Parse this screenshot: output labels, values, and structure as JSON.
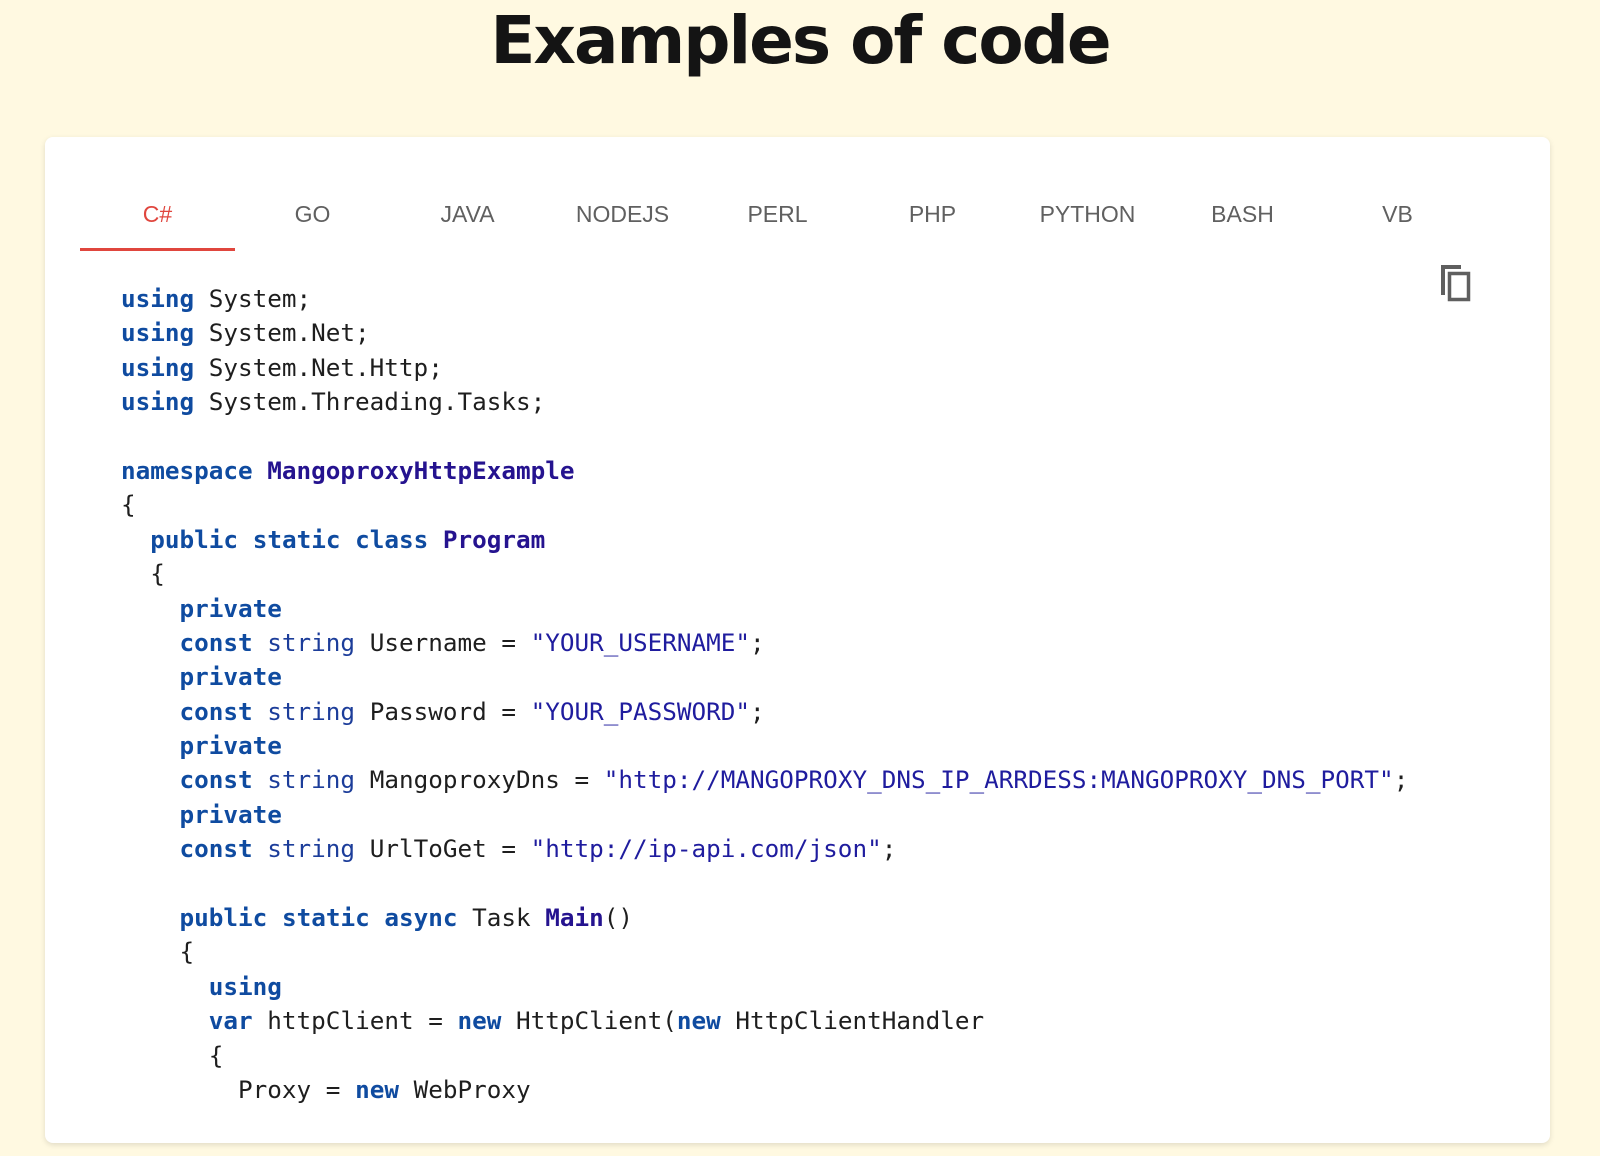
{
  "page": {
    "heading": "Examples of code"
  },
  "tabs": [
    {
      "label": "C#",
      "active": true
    },
    {
      "label": "GO",
      "active": false
    },
    {
      "label": "JAVA",
      "active": false
    },
    {
      "label": "NODEJS",
      "active": false
    },
    {
      "label": "PERL",
      "active": false
    },
    {
      "label": "PHP",
      "active": false
    },
    {
      "label": "PYTHON",
      "active": false
    },
    {
      "label": "BASH",
      "active": false
    },
    {
      "label": "VB",
      "active": false
    }
  ],
  "copy_button": {
    "icon": "copy-icon"
  },
  "colors": {
    "background": "#fff9e1",
    "accent": "#e0463e",
    "keyword": "#0f4ba0",
    "string": "#1f1c9e"
  },
  "code": {
    "language": "C#",
    "lines": [
      [
        {
          "t": "using",
          "c": "kw"
        },
        {
          "t": " System;",
          "c": "plain"
        }
      ],
      [
        {
          "t": "using",
          "c": "kw"
        },
        {
          "t": " System.Net;",
          "c": "plain"
        }
      ],
      [
        {
          "t": "using",
          "c": "kw"
        },
        {
          "t": " System.Net.Http;",
          "c": "plain"
        }
      ],
      [
        {
          "t": "using",
          "c": "kw"
        },
        {
          "t": " System.Threading.Tasks;",
          "c": "plain"
        }
      ],
      [],
      [
        {
          "t": "namespace",
          "c": "kw"
        },
        {
          "t": " ",
          "c": "plain"
        },
        {
          "t": "MangoproxyHttpExample",
          "c": "name"
        }
      ],
      [
        {
          "t": "{",
          "c": "plain"
        }
      ],
      [
        {
          "t": "  ",
          "c": "plain"
        },
        {
          "t": "public",
          "c": "kw"
        },
        {
          "t": " ",
          "c": "plain"
        },
        {
          "t": "static",
          "c": "kw"
        },
        {
          "t": " ",
          "c": "plain"
        },
        {
          "t": "class",
          "c": "kw"
        },
        {
          "t": " ",
          "c": "plain"
        },
        {
          "t": "Program",
          "c": "name"
        }
      ],
      [
        {
          "t": "  {",
          "c": "plain"
        }
      ],
      [
        {
          "t": "    ",
          "c": "plain"
        },
        {
          "t": "private",
          "c": "kw"
        }
      ],
      [
        {
          "t": "    ",
          "c": "plain"
        },
        {
          "t": "const",
          "c": "kw"
        },
        {
          "t": " ",
          "c": "plain"
        },
        {
          "t": "string",
          "c": "type"
        },
        {
          "t": " Username = ",
          "c": "plain"
        },
        {
          "t": "\"YOUR_USERNAME\"",
          "c": "str"
        },
        {
          "t": ";",
          "c": "plain"
        }
      ],
      [
        {
          "t": "    ",
          "c": "plain"
        },
        {
          "t": "private",
          "c": "kw"
        }
      ],
      [
        {
          "t": "    ",
          "c": "plain"
        },
        {
          "t": "const",
          "c": "kw"
        },
        {
          "t": " ",
          "c": "plain"
        },
        {
          "t": "string",
          "c": "type"
        },
        {
          "t": " Password = ",
          "c": "plain"
        },
        {
          "t": "\"YOUR_PASSWORD\"",
          "c": "str"
        },
        {
          "t": ";",
          "c": "plain"
        }
      ],
      [
        {
          "t": "    ",
          "c": "plain"
        },
        {
          "t": "private",
          "c": "kw"
        }
      ],
      [
        {
          "t": "    ",
          "c": "plain"
        },
        {
          "t": "const",
          "c": "kw"
        },
        {
          "t": " ",
          "c": "plain"
        },
        {
          "t": "string",
          "c": "type"
        },
        {
          "t": " MangoproxyDns = ",
          "c": "plain"
        },
        {
          "t": "\"http://MANGOPROXY_DNS_IP_ARRDESS:MANGOPROXY_DNS_PORT\"",
          "c": "str"
        },
        {
          "t": ";",
          "c": "plain"
        }
      ],
      [
        {
          "t": "    ",
          "c": "plain"
        },
        {
          "t": "private",
          "c": "kw"
        }
      ],
      [
        {
          "t": "    ",
          "c": "plain"
        },
        {
          "t": "const",
          "c": "kw"
        },
        {
          "t": " ",
          "c": "plain"
        },
        {
          "t": "string",
          "c": "type"
        },
        {
          "t": " UrlToGet = ",
          "c": "plain"
        },
        {
          "t": "\"http://ip-api.com/json\"",
          "c": "str"
        },
        {
          "t": ";",
          "c": "plain"
        }
      ],
      [],
      [
        {
          "t": "    ",
          "c": "plain"
        },
        {
          "t": "public",
          "c": "kw"
        },
        {
          "t": " ",
          "c": "plain"
        },
        {
          "t": "static",
          "c": "kw"
        },
        {
          "t": " ",
          "c": "plain"
        },
        {
          "t": "async",
          "c": "kw"
        },
        {
          "t": " Task ",
          "c": "plain"
        },
        {
          "t": "Main",
          "c": "name"
        },
        {
          "t": "()",
          "c": "plain"
        }
      ],
      [
        {
          "t": "    {",
          "c": "plain"
        }
      ],
      [
        {
          "t": "      ",
          "c": "plain"
        },
        {
          "t": "using",
          "c": "kw"
        }
      ],
      [
        {
          "t": "      ",
          "c": "plain"
        },
        {
          "t": "var",
          "c": "kw"
        },
        {
          "t": " httpClient = ",
          "c": "plain"
        },
        {
          "t": "new",
          "c": "kw"
        },
        {
          "t": " HttpClient(",
          "c": "plain"
        },
        {
          "t": "new",
          "c": "kw"
        },
        {
          "t": " HttpClientHandler",
          "c": "plain"
        }
      ],
      [
        {
          "t": "      {",
          "c": "plain"
        }
      ],
      [
        {
          "t": "        Proxy = ",
          "c": "plain"
        },
        {
          "t": "new",
          "c": "kw"
        },
        {
          "t": " WebProxy",
          "c": "plain"
        }
      ]
    ]
  }
}
